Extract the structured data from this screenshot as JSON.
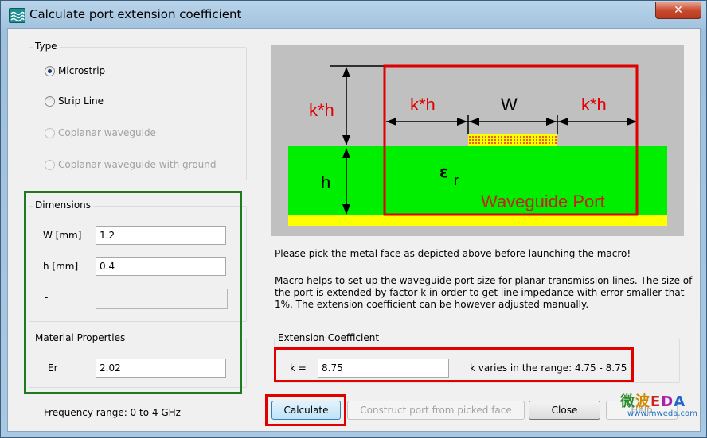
{
  "window": {
    "title": "Calculate port extension coefficient",
    "close_glyph": "✕"
  },
  "type_group": {
    "title": "Type",
    "options": [
      "Microstrip",
      "Strip Line",
      "Coplanar waveguide",
      "Coplanar waveguide with ground"
    ],
    "selected": "Microstrip"
  },
  "dimensions": {
    "title": "Dimensions",
    "w_label": "W [mm]",
    "w_value": "1.2",
    "h_label": "h [mm]",
    "h_value": "0.4",
    "extra_label": "-",
    "extra_value": ""
  },
  "material": {
    "title": "Material Properties",
    "er_label": "Er",
    "er_value": "2.02"
  },
  "frequency_text": "Frequency range: 0 to 4 GHz",
  "diagram": {
    "kh_label": "k*h",
    "w_label": "W",
    "h_label": "h",
    "eps_symbol": "ε",
    "eps_sub": "r",
    "port_label": "Waveguide Port",
    "colors": {
      "background": "#c0c0c0",
      "substrate": "#00ee00",
      "ground": "#ffff00",
      "highlight": "#e00000"
    }
  },
  "instructions": {
    "line1": "Please pick the metal face as depicted above before launching the macro!",
    "para_line1": "Macro helps to set up the waveguide port size for planar transmission lines. The size of",
    "para_line2": "the port is extended by factor k in order to get line impedance with error smaller that",
    "para_line3": "1%. The extension coefficient can be however adjusted manually."
  },
  "extension": {
    "title": "Extension Coefficient",
    "k_label": "k =",
    "k_value": "8.75",
    "range_text": "k varies in the range: 4.75 - 8.75"
  },
  "buttons": {
    "calculate": "Calculate",
    "construct": "Construct port from picked face",
    "close": "Close",
    "help": "Help"
  },
  "watermark": {
    "chars": [
      "微",
      "波",
      "E",
      "D",
      "A"
    ],
    "url": "www.mweda.com"
  }
}
